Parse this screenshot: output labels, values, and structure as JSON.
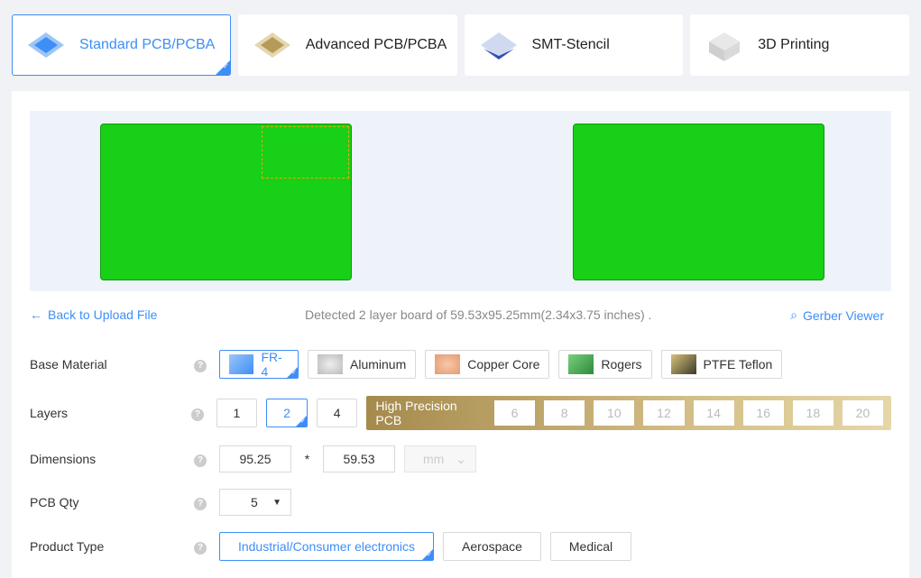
{
  "tabs": [
    {
      "label": "Standard PCB/PCBA",
      "active": true,
      "icon": "standard-pcb-icon"
    },
    {
      "label": "Advanced PCB/PCBA",
      "active": false,
      "icon": "advanced-pcb-icon"
    },
    {
      "label": "SMT-Stencil",
      "active": false,
      "icon": "smt-stencil-icon"
    },
    {
      "label": "3D Printing",
      "active": false,
      "icon": "3d-printing-icon"
    }
  ],
  "preview": {
    "boards": [
      "top-layer",
      "bottom-layer"
    ]
  },
  "links": {
    "back": "Back to Upload File",
    "detected": "Detected 2 layer board of 59.53x95.25mm(2.34x3.75 inches) .",
    "gerber": "Gerber Viewer"
  },
  "base_material": {
    "label": "Base Material",
    "options": [
      {
        "label": "FR-4",
        "selected": true
      },
      {
        "label": "Aluminum",
        "selected": false
      },
      {
        "label": "Copper Core",
        "selected": false
      },
      {
        "label": "Rogers",
        "selected": false
      },
      {
        "label": "PTFE Teflon",
        "selected": false
      }
    ]
  },
  "layers": {
    "label": "Layers",
    "options": [
      "1",
      "2",
      "4"
    ],
    "selected": "2",
    "high_precision_label": "High Precision PCB",
    "high_precision_options": [
      "6",
      "8",
      "10",
      "12",
      "14",
      "16",
      "18",
      "20"
    ]
  },
  "dimensions": {
    "label": "Dimensions",
    "width": "95.25",
    "sep": "*",
    "height": "59.53",
    "unit": "mm"
  },
  "qty": {
    "label": "PCB Qty",
    "value": "5"
  },
  "product_type": {
    "label": "Product Type",
    "options": [
      {
        "label": "Industrial/Consumer electronics",
        "selected": true
      },
      {
        "label": "Aerospace",
        "selected": false
      },
      {
        "label": "Medical",
        "selected": false
      }
    ]
  },
  "colors": {
    "accent": "#3e8ef7",
    "board": "#17d017"
  }
}
